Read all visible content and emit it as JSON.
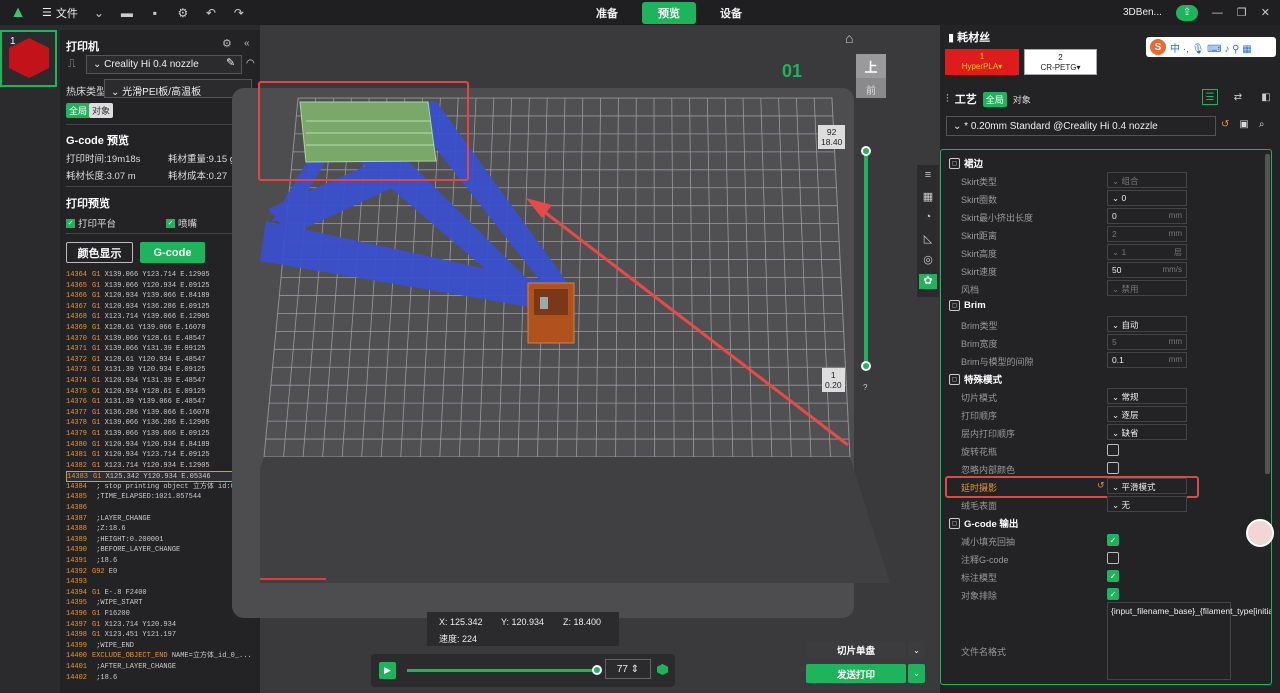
{
  "topbar": {
    "menu_label": "文件",
    "tabs": [
      {
        "label": "准备",
        "active": false
      },
      {
        "label": "预览",
        "active": true
      },
      {
        "label": "设备",
        "active": false
      }
    ],
    "device": "3DBen..."
  },
  "left": {
    "plate_number": "1",
    "printer_title": "打印机",
    "printer_name": "Creality Hi 0.4 nozzle",
    "bed_label": "热床类型",
    "bed_value": "光滑PEI板/高温板",
    "chip_global": "全局",
    "chip_object": "对象",
    "gcode_title": "G-code 预览",
    "print_time": "打印时间:19m18s",
    "filament_weight": "耗材重量:9.15 g",
    "filament_length": "耗材长度:3.07 m",
    "filament_cost": "耗材成本:0.27",
    "preview_title": "打印预览",
    "cb_plate": "打印平台",
    "cb_nozzle": "喷嘴",
    "btn_color": "颜色显示",
    "btn_gcode": "G-code",
    "gcode_lines": [
      {
        "n": "14364",
        "c": "G1",
        "t": " X139.066 Y123.714 E.12905"
      },
      {
        "n": "14365",
        "c": "G1",
        "t": " X139.066 Y120.934 E.09125"
      },
      {
        "n": "14366",
        "c": "G1",
        "t": " X120.934 Y139.066 E.84189"
      },
      {
        "n": "14367",
        "c": "G1",
        "t": " X120.934 Y136.286 E.09125"
      },
      {
        "n": "14368",
        "c": "G1",
        "t": " X123.714 Y139.066 E.12905"
      },
      {
        "n": "14369",
        "c": "G1",
        "t": " X128.61 Y139.066 E.16078"
      },
      {
        "n": "14370",
        "c": "G1",
        "t": " X139.066 Y128.61 E.48547"
      },
      {
        "n": "14371",
        "c": "G1",
        "t": " X139.066 Y131.39 E.09125"
      },
      {
        "n": "14372",
        "c": "G1",
        "t": " X128.61 Y120.934 E.48547"
      },
      {
        "n": "14373",
        "c": "G1",
        "t": " X131.39 Y120.934 E.09125"
      },
      {
        "n": "14374",
        "c": "G1",
        "t": " X120.934 Y131.39 E.48547"
      },
      {
        "n": "14375",
        "c": "G1",
        "t": " X120.934 Y128.61 E.09125"
      },
      {
        "n": "14376",
        "c": "G1",
        "t": " X131.39 Y139.066 E.48547"
      },
      {
        "n": "14377",
        "c": "G1",
        "t": " X136.286 Y139.066 E.16078"
      },
      {
        "n": "14378",
        "c": "G1",
        "t": " X139.066 Y136.286 E.12905"
      },
      {
        "n": "14379",
        "c": "G1",
        "t": " X139.066 Y139.066 E.09125"
      },
      {
        "n": "14380",
        "c": "G1",
        "t": " X120.934 Y120.934 E.84189"
      },
      {
        "n": "14381",
        "c": "G1",
        "t": " X120.934 Y123.714 E.09125"
      },
      {
        "n": "14382",
        "c": "G1",
        "t": " X123.714 Y120.934 E.12905"
      },
      {
        "n": "14383",
        "c": "G1",
        "t": " X125.342 Y120.934 E.05346",
        "hl": true
      },
      {
        "n": "14384",
        "c": "",
        "t": " ; stop printing object 立方体 id:0 c..."
      },
      {
        "n": "14385",
        "c": "",
        "t": " ;TIME_ELAPSED:1021.857544"
      },
      {
        "n": "14386",
        "c": "",
        "t": ""
      },
      {
        "n": "14387",
        "c": "",
        "t": " ;LAYER_CHANGE"
      },
      {
        "n": "14388",
        "c": "",
        "t": " ;Z:18.6"
      },
      {
        "n": "14389",
        "c": "",
        "t": " ;HEIGHT:0.200001"
      },
      {
        "n": "14390",
        "c": "",
        "t": " ;BEFORE_LAYER_CHANGE"
      },
      {
        "n": "14391",
        "c": "",
        "t": " ;18.6"
      },
      {
        "n": "14392",
        "c": "G92",
        "t": " E0"
      },
      {
        "n": "14393",
        "c": "",
        "t": ""
      },
      {
        "n": "14394",
        "c": "G1",
        "t": " E-.8 F2400"
      },
      {
        "n": "14395",
        "c": "",
        "t": " ;WIPE_START"
      },
      {
        "n": "14396",
        "c": "G1",
        "t": " F16200"
      },
      {
        "n": "14397",
        "c": "G1",
        "t": " X123.714 Y120.934"
      },
      {
        "n": "14398",
        "c": "G1",
        "t": " X123.451 Y121.197"
      },
      {
        "n": "14399",
        "c": "",
        "t": " ;WIPE_END"
      },
      {
        "n": "14400",
        "c": "EXCLUDE_OBJECT_END",
        "t": " NAME=立方体_id_0_..."
      },
      {
        "n": "14401",
        "c": "",
        "t": " ;AFTER_LAYER_CHANGE"
      },
      {
        "n": "14402",
        "c": "",
        "t": " ;18.6"
      }
    ]
  },
  "viewport": {
    "plate_label": "01",
    "view_top": "上",
    "view_front": "前",
    "layer_top": "92",
    "layer_top_h": "18.40",
    "layer_bottom": "1",
    "layer_bottom_h": "0.20",
    "question": "?",
    "coord_x": "X: 125.342",
    "coord_y": "Y: 120.934",
    "coord_z": "Z: 18.400",
    "speed": "速度: 224",
    "progress_value": "77",
    "slice_btn": "切片单盘",
    "send_btn": "发送打印"
  },
  "right": {
    "filament_title": "耗材丝",
    "fil1_num": "1",
    "fil1_name": "HyperPLA▾",
    "fil2_num": "2",
    "fil2_name": "CR-PETG▾",
    "ime_text": "中 ·, 🎙 ⌨ ♪ ⚲ ▦",
    "process_title": "工艺",
    "chip_global": "全局",
    "chip_object": "对象",
    "preset": "* 0.20mm Standard @Creality Hi 0.4 nozzle",
    "sections": {
      "skirt": "裙边",
      "brim": "Brim",
      "special": "特殊模式",
      "gcode_out": "G-code 输出"
    },
    "rows": {
      "skirt_type": "Skirt类型",
      "skirt_type_v": "组合",
      "skirt_loops": "Skirt圈数",
      "skirt_loops_v": "0",
      "skirt_min": "Skirt最小挤出长度",
      "skirt_min_v": "0",
      "unit_mm": "mm",
      "skirt_dist": "Skirt距离",
      "skirt_dist_v": "2",
      "skirt_height": "Skirt高度",
      "skirt_height_v": "1",
      "unit_layer": "层",
      "skirt_speed": "Skirt速度",
      "skirt_speed_v": "50",
      "unit_mms": "mm/s",
      "draft": "风档",
      "draft_v": "禁用",
      "brim_type": "Brim类型",
      "brim_type_v": "自动",
      "brim_width": "Brim宽度",
      "brim_width_v": "5",
      "brim_gap": "Brim与模型的间隙",
      "brim_gap_v": "0.1",
      "slice_mode": "切片模式",
      "slice_mode_v": "常规",
      "print_seq": "打印顺序",
      "print_seq_v": "逐层",
      "layer_seq": "层内打印顺序",
      "layer_seq_v": "缺省",
      "spiral": "旋转花瓶",
      "ignore_color": "忽略内部颜色",
      "timelapse": "延时摄影",
      "timelapse_v": "平滑模式",
      "fuzzy": "绒毛表面",
      "fuzzy_v": "无",
      "reduce_infill": "减小填充回抽",
      "comment_gcode": "注释G-code",
      "label_model": "标注模型",
      "exclude_obj": "对象排除",
      "filename_fmt": "文件名格式",
      "filename_v": "{input_filename_base}_{filament_type[initial_tool]}_{print_time}.gcode"
    }
  }
}
